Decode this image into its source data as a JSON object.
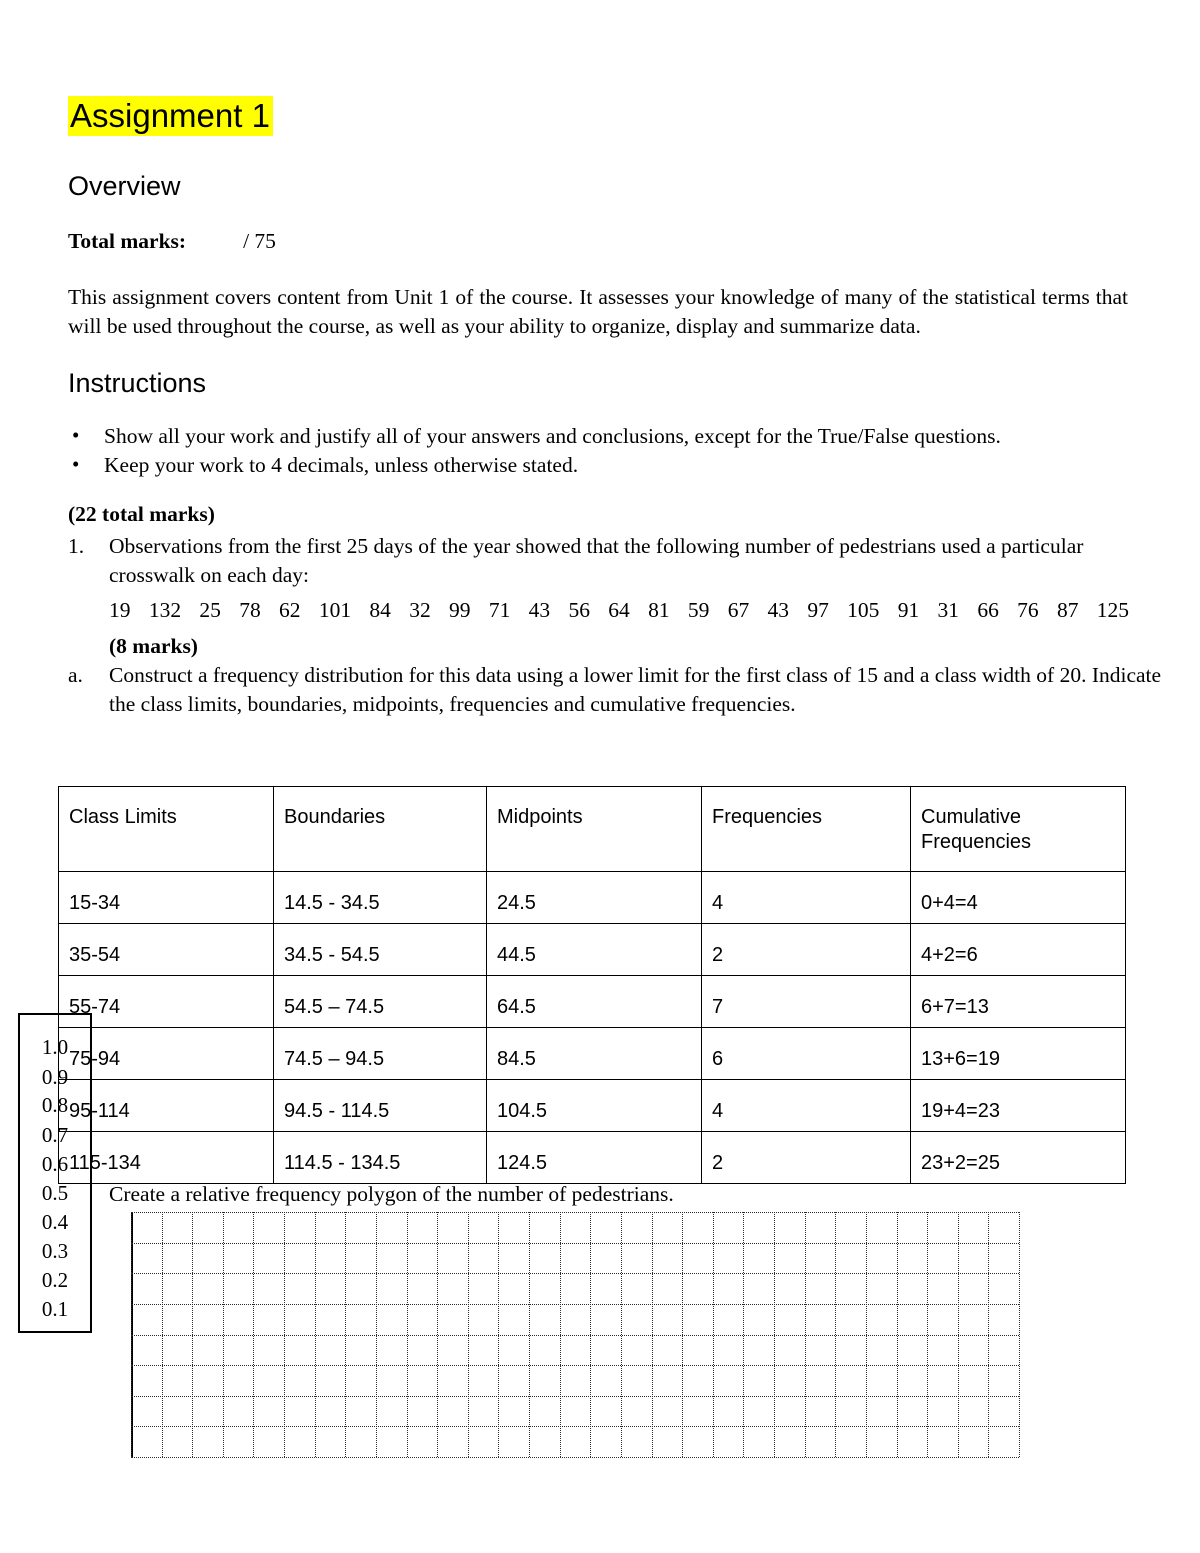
{
  "document": {
    "title": "Assignment 1",
    "overview_heading": "Overview",
    "total_marks_label": "Total marks:",
    "total_marks_value": "/ 75",
    "overview_paragraph": "This assignment covers content from Unit 1 of the course. It assesses your knowledge of many of the statistical terms that will be used throughout the course, as well as your ability to organize, display and summarize data.",
    "instructions_heading": "Instructions",
    "instructions": [
      "Show all your work and justify all of your answers and conclusions, except for the True/False questions.",
      "Keep your work to 4 decimals, unless otherwise stated."
    ],
    "section_marks": "(22 total marks)",
    "question_1_marker": "1.",
    "question_1_text": "Observations from the first 25 days of the year showed that the following number of pedestrians used a particular crosswalk on each day:",
    "data_values": [
      "19",
      "132",
      "25",
      "78",
      "62",
      "101",
      "84",
      "32",
      "99",
      "71",
      "43",
      "56",
      "64",
      "81",
      "59",
      "67",
      "43",
      "97",
      "105",
      "91",
      "31",
      "66",
      "76",
      "87",
      "125"
    ],
    "part_a_marks": "(8 marks)",
    "part_a_marker": "a.",
    "part_a_text": "Construct a frequency distribution for this data using a lower limit for the first class of 15 and a class width of 20. Indicate the class limits, boundaries, midpoints, frequencies and cumulative frequencies.",
    "polygon_prompt": "Create a relative frequency polygon of the number of pedestrians.",
    "highlight_color": "#ffff00"
  },
  "frequency_table": {
    "headers": [
      "Class Limits",
      "Boundaries",
      "Midpoints",
      "Frequencies",
      "Cumulative Frequencies"
    ],
    "header_cumulative_line1": "Cumulative",
    "header_cumulative_line2": "Frequencies",
    "rows": [
      {
        "class_limits": "15-34",
        "boundaries": "14.5 - 34.5",
        "midpoint": "24.5",
        "frequency": "4",
        "cumulative": "0+4=4"
      },
      {
        "class_limits": "35-54",
        "boundaries": "34.5 - 54.5",
        "midpoint": "44.5",
        "frequency": "2",
        "cumulative": "4+2=6"
      },
      {
        "class_limits": "55-74",
        "boundaries": "54.5 – 74.5",
        "midpoint": "64.5",
        "frequency": "7",
        "cumulative": "6+7=13"
      },
      {
        "class_limits": "75-94",
        "boundaries": "74.5 – 94.5",
        "midpoint": "84.5",
        "frequency": "6",
        "cumulative": "13+6=19"
      },
      {
        "class_limits": "95-114",
        "boundaries": "94.5 - 114.5",
        "midpoint": "104.5",
        "frequency": "4",
        "cumulative": "19+4=23"
      },
      {
        "class_limits": "115-134",
        "boundaries": "114.5 - 134.5",
        "midpoint": "124.5",
        "frequency": "2",
        "cumulative": "23+2=25"
      }
    ]
  },
  "chart_data": {
    "type": "line",
    "title": "Create a relative frequency polygon of the number of pedestrians.",
    "xlabel": "",
    "ylabel": "",
    "ylim": [
      0,
      1.0
    ],
    "ytick_labels": [
      "1.0",
      "0.9",
      "0.8",
      "0.7",
      "0.6",
      "0.5",
      "0.4",
      "0.3",
      "0.2",
      "0.1"
    ],
    "ytick_values": [
      1.0,
      0.9,
      0.8,
      0.7,
      0.6,
      0.5,
      0.4,
      0.3,
      0.2,
      0.1
    ],
    "grid": true,
    "grid_columns": 29,
    "grid_rows": 8,
    "legend": null,
    "series": [
      {
        "name": "relative frequency polygon",
        "values": []
      }
    ],
    "categories": [],
    "note": "Blank graph paper grid provided for the student to draw the polygon; no data plotted."
  }
}
